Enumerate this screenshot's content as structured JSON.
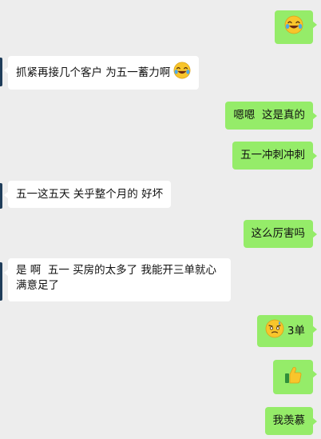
{
  "messages": [
    {
      "id": "m1",
      "side": "out",
      "emoji": "laughing-crying-face-icon",
      "text": ""
    },
    {
      "id": "m2",
      "side": "in",
      "text": "抓紧再接几个客户 为五一蓄力啊",
      "emoji": "laughing-crying-face-icon"
    },
    {
      "id": "m3",
      "side": "out",
      "text": "嗯嗯  这是真的"
    },
    {
      "id": "m4",
      "side": "out",
      "text": "五一冲刺冲刺"
    },
    {
      "id": "m5",
      "side": "in",
      "text": "五一这五天 关乎整个月的 好坏"
    },
    {
      "id": "m6",
      "side": "out",
      "text": "这么厉害吗"
    },
    {
      "id": "m7",
      "side": "in",
      "text_line1": "是 啊  五一 买房的太多了 我能开三单就心",
      "text_line2": "满意足了"
    },
    {
      "id": "m8",
      "side": "out",
      "emoji": "sweat-smile-face-icon",
      "text": "3单"
    },
    {
      "id": "m9",
      "side": "out",
      "emoji": "thumbs-up-icon",
      "text": ""
    },
    {
      "id": "m10",
      "side": "out",
      "text": "我羡慕"
    }
  ],
  "colors": {
    "background": "#ededed",
    "outgoing_bubble": "#95ec69",
    "incoming_bubble": "#ffffff",
    "avatar_edge": "#1f3d5a"
  }
}
